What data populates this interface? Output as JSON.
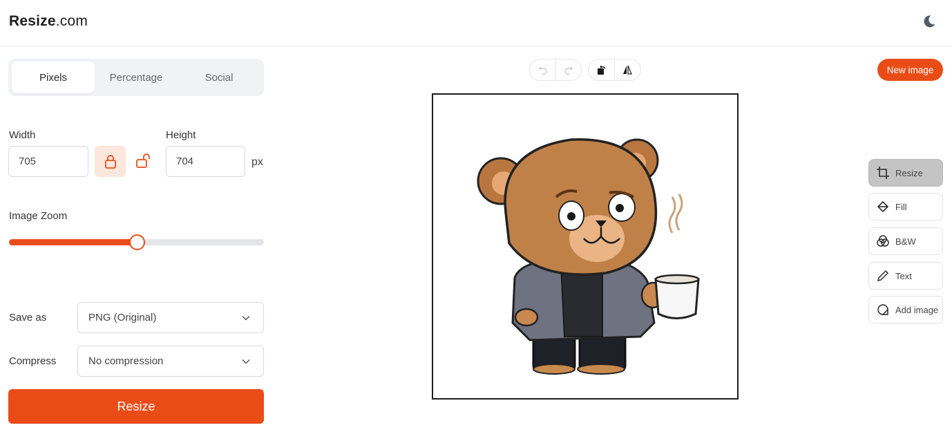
{
  "app": {
    "logo_bold": "Resize",
    "logo_light": ".com",
    "theme_icon": "moon-icon"
  },
  "tabs": [
    {
      "label": "Pixels",
      "active": true
    },
    {
      "label": "Percentage",
      "active": false
    },
    {
      "label": "Social",
      "active": false
    }
  ],
  "dimensions": {
    "width_label": "Width",
    "width_value": "705",
    "height_label": "Height",
    "height_value": "704",
    "unit": "px",
    "lock_icon": "lock-icon",
    "unlock_icon": "unlock-icon"
  },
  "zoom": {
    "label": "Image Zoom",
    "value_fraction": 0.5
  },
  "save_as": {
    "label": "Save as",
    "value": "PNG (Original)"
  },
  "compress": {
    "label": "Compress",
    "value": "No compression"
  },
  "resize_button": "Resize",
  "toolbar": {
    "undo_icon": "undo-icon",
    "redo_icon": "redo-icon",
    "rotate_icon": "rotate-icon",
    "flip_icon": "flip-icon"
  },
  "new_image_button": "New image",
  "tools": [
    {
      "label": "Resize",
      "icon": "crop-icon",
      "active": true
    },
    {
      "label": "Fill",
      "icon": "fill-icon",
      "active": false
    },
    {
      "label": "B&W",
      "icon": "bw-icon",
      "active": false
    },
    {
      "label": "Text",
      "icon": "pencil-icon",
      "active": false
    },
    {
      "label": "Add image",
      "icon": "add-image-icon",
      "active": false
    }
  ],
  "colors": {
    "accent": "#ea4c18",
    "accent_light": "#fde6dc",
    "tool_active": "#c4c4c4"
  }
}
